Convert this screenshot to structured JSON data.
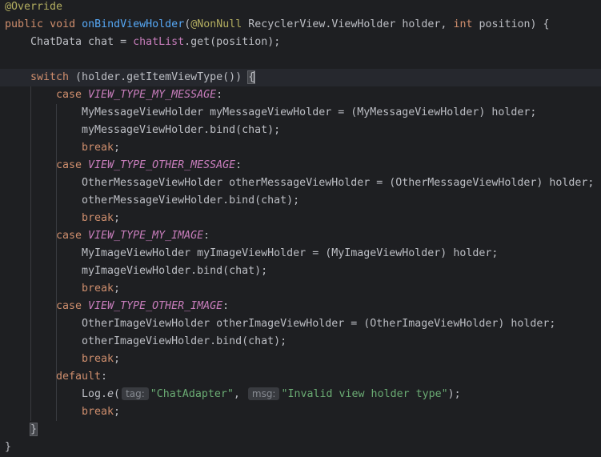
{
  "editor": {
    "annotation_override": "@Override",
    "sig_public": "public",
    "sig_void": "void",
    "method_name": "onBindViewHolder",
    "paren_open": "(",
    "annotation_nonnull": "@NonNull",
    "param1_type": " RecyclerView.ViewHolder holder, ",
    "kw_int": "int",
    "param2": " position) {",
    "chat_decl_prefix": "ChatData chat = ",
    "chat_list_field": "chatList",
    "chat_decl_suffix": ".get(position);",
    "kw_switch": "switch",
    "switch_expr": " (holder.getItemViewType()) ",
    "brace_open": "{",
    "kw_case": "case",
    "kw_break": "break",
    "kw_default": "default",
    "colon": ":",
    "semicolon": ";",
    "case1_const": "VIEW_TYPE_MY_MESSAGE",
    "case1_stmt1": "MyMessageViewHolder myMessageViewHolder = (MyMessageViewHolder) holder;",
    "case1_stmt2": "myMessageViewHolder.bind(chat);",
    "case2_const": "VIEW_TYPE_OTHER_MESSAGE",
    "case2_stmt1": "OtherMessageViewHolder otherMessageViewHolder = (OtherMessageViewHolder) holder;",
    "case2_stmt2": "otherMessageViewHolder.bind(chat);",
    "case3_const": "VIEW_TYPE_MY_IMAGE",
    "case3_stmt1": "MyImageViewHolder myImageViewHolder = (MyImageViewHolder) holder;",
    "case3_stmt2": "myImageViewHolder.bind(chat);",
    "case4_const": "VIEW_TYPE_OTHER_IMAGE",
    "case4_stmt1": "OtherImageViewHolder otherImageViewHolder = (OtherImageViewHolder) holder;",
    "case4_stmt2": "otherImageViewHolder.bind(chat);",
    "log_prefix": "Log.",
    "log_method": "e",
    "log_paren": "(",
    "hint_tag": "tag:",
    "log_tag_value": "\"ChatAdapter\"",
    "comma": ", ",
    "hint_msg": "msg:",
    "log_msg_value": "\"Invalid view holder type\"",
    "log_suffix": ");",
    "brace_close": "}"
  },
  "colors": {
    "background": "#1e1f22",
    "current_line": "#26282e",
    "keyword": "#cf8e6d",
    "annotation": "#b3ae60",
    "function": "#56a8f5",
    "constant": "#c77dbb",
    "string": "#6aab73",
    "text": "#bcbec4"
  }
}
